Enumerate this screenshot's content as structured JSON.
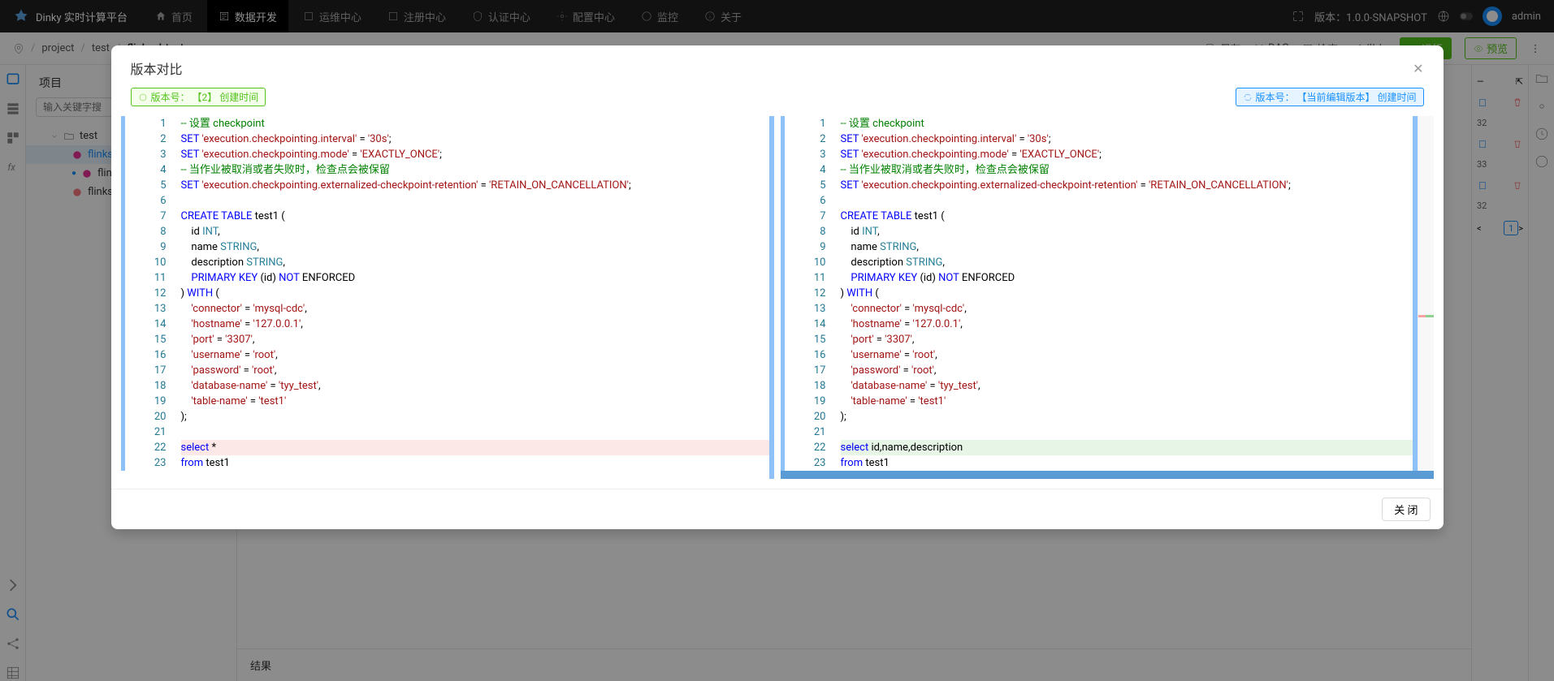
{
  "header": {
    "app_name": "Dinky 实时计算平台",
    "nav": [
      "首页",
      "数据开发",
      "运维中心",
      "注册中心",
      "认证中心",
      "配置中心",
      "监控",
      "关于"
    ],
    "version_label": "版本：",
    "version": "1.0.0-SNAPSHOT",
    "username": "admin"
  },
  "breadcrumb": [
    "project",
    "test",
    "flinksql-test"
  ],
  "toolbar": {
    "save": "保存",
    "dag": "DAG",
    "check": "检查",
    "publish": "发布",
    "run": "运行",
    "preview": "预览"
  },
  "sidebar": {
    "title": "项目",
    "search_ph": "输入关键字搜",
    "root": "test",
    "files": [
      "flinksql-test",
      "flinksql-test",
      "flinksql-test"
    ]
  },
  "result_label": "结果",
  "right_panel": {
    "rows": [
      "32",
      "33",
      "32",
      ""
    ],
    "page": "1"
  },
  "modal": {
    "title": "版本对比",
    "left_tag": "版本号： 【2】 创建时间",
    "right_tag": "版本号： 【当前编辑版本】 创建时间",
    "close_btn": "关 闭",
    "left_code": [
      {
        "n": 1,
        "h": "<span class='tok-cmt'>-- 设置 checkpoint</span>"
      },
      {
        "n": 2,
        "h": "<span class='tok-kw'>SET</span> <span class='tok-str'>'execution.checkpointing.interval'</span> = <span class='tok-str'>'30s'</span>;"
      },
      {
        "n": 3,
        "h": "<span class='tok-kw'>SET</span> <span class='tok-str'>'execution.checkpointing.mode'</span> = <span class='tok-str'>'EXACTLY_ONCE'</span>;"
      },
      {
        "n": 4,
        "h": "<span class='tok-cmt'>-- 当作业被取消或者失败时，检查点会被保留</span>"
      },
      {
        "n": 5,
        "h": "<span class='tok-kw'>SET</span> <span class='tok-str'>'execution.checkpointing.externalized-checkpoint-retention'</span> = <span class='tok-str'>'RETAIN_ON_CANCELLATION'</span>;"
      },
      {
        "n": 6,
        "h": ""
      },
      {
        "n": 7,
        "h": "<span class='tok-kw'>CREATE</span> <span class='tok-kw'>TABLE</span> test1 ("
      },
      {
        "n": 8,
        "h": "    id <span class='tok-type'>INT</span>,"
      },
      {
        "n": 9,
        "h": "    name <span class='tok-type'>STRING</span>,"
      },
      {
        "n": 10,
        "h": "    description <span class='tok-type'>STRING</span>,"
      },
      {
        "n": 11,
        "h": "    <span class='tok-kw'>PRIMARY</span> <span class='tok-kw'>KEY</span> (id) <span class='tok-kw'>NOT</span> ENFORCED"
      },
      {
        "n": 12,
        "h": ") <span class='tok-kw'>WITH</span> ("
      },
      {
        "n": 13,
        "h": "    <span class='tok-str'>'connector'</span> = <span class='tok-str'>'mysql-cdc'</span>,"
      },
      {
        "n": 14,
        "h": "    <span class='tok-str'>'hostname'</span> = <span class='tok-str'>'127.0.0.1'</span>,"
      },
      {
        "n": 15,
        "h": "    <span class='tok-str'>'port'</span> = <span class='tok-str'>'3307'</span>,"
      },
      {
        "n": 16,
        "h": "    <span class='tok-str'>'username'</span> = <span class='tok-str'>'root'</span>,"
      },
      {
        "n": 17,
        "h": "    <span class='tok-str'>'password'</span> = <span class='tok-str'>'root'</span>,"
      },
      {
        "n": 18,
        "h": "    <span class='tok-str'>'database-name'</span> = <span class='tok-str'>'tyy_test'</span>,"
      },
      {
        "n": 19,
        "h": "    <span class='tok-str'>'table-name'</span> = <span class='tok-str'>'test1'</span>"
      },
      {
        "n": 20,
        "h": ");"
      },
      {
        "n": 21,
        "h": ""
      },
      {
        "n": 22,
        "h": "<span class='tok-kw'>select</span> <span class='tok-star'>*</span>",
        "cls": "diff-del",
        "sym": "−"
      },
      {
        "n": 23,
        "h": "<span class='tok-kw'>from</span> test1"
      }
    ],
    "right_code": [
      {
        "n": 1,
        "h": "<span class='tok-cmt'>-- 设置 checkpoint</span>"
      },
      {
        "n": 2,
        "h": "<span class='tok-kw'>SET</span> <span class='tok-str'>'execution.checkpointing.interval'</span> = <span class='tok-str'>'30s'</span>;"
      },
      {
        "n": 3,
        "h": "<span class='tok-kw'>SET</span> <span class='tok-str'>'execution.checkpointing.mode'</span> = <span class='tok-str'>'EXACTLY_ONCE'</span>;"
      },
      {
        "n": 4,
        "h": "<span class='tok-cmt'>-- 当作业被取消或者失败时，检查点会被保留</span>"
      },
      {
        "n": 5,
        "h": "<span class='tok-kw'>SET</span> <span class='tok-str'>'execution.checkpointing.externalized-checkpoint-retention'</span> = <span class='tok-str'>'RETAIN_ON_CANCELLATION'</span>;"
      },
      {
        "n": 6,
        "h": ""
      },
      {
        "n": 7,
        "h": "<span class='tok-kw'>CREATE</span> <span class='tok-kw'>TABLE</span> test1 ("
      },
      {
        "n": 8,
        "h": "    id <span class='tok-type'>INT</span>,"
      },
      {
        "n": 9,
        "h": "    name <span class='tok-type'>STRING</span>,"
      },
      {
        "n": 10,
        "h": "    description <span class='tok-type'>STRING</span>,"
      },
      {
        "n": 11,
        "h": "    <span class='tok-kw'>PRIMARY</span> <span class='tok-kw'>KEY</span> (id) <span class='tok-kw'>NOT</span> ENFORCED"
      },
      {
        "n": 12,
        "h": ") <span class='tok-kw'>WITH</span> ("
      },
      {
        "n": 13,
        "h": "    <span class='tok-str'>'connector'</span> = <span class='tok-str'>'mysql-cdc'</span>,"
      },
      {
        "n": 14,
        "h": "    <span class='tok-str'>'hostname'</span> = <span class='tok-str'>'127.0.0.1'</span>,"
      },
      {
        "n": 15,
        "h": "    <span class='tok-str'>'port'</span> = <span class='tok-str'>'3307'</span>,"
      },
      {
        "n": 16,
        "h": "    <span class='tok-str'>'username'</span> = <span class='tok-str'>'root'</span>,"
      },
      {
        "n": 17,
        "h": "    <span class='tok-str'>'password'</span> = <span class='tok-str'>'root'</span>,"
      },
      {
        "n": 18,
        "h": "    <span class='tok-str'>'database-name'</span> = <span class='tok-str'>'tyy_test'</span>,"
      },
      {
        "n": 19,
        "h": "    <span class='tok-str'>'table-name'</span> = <span class='tok-str'>'test1'</span>"
      },
      {
        "n": 20,
        "h": ");"
      },
      {
        "n": 21,
        "h": ""
      },
      {
        "n": 22,
        "h": "<span class='tok-kw'>select</span> id,name,description",
        "cls": "diff-add",
        "sym": "+"
      },
      {
        "n": 23,
        "h": "<span class='tok-kw'>from</span> test1"
      }
    ]
  }
}
